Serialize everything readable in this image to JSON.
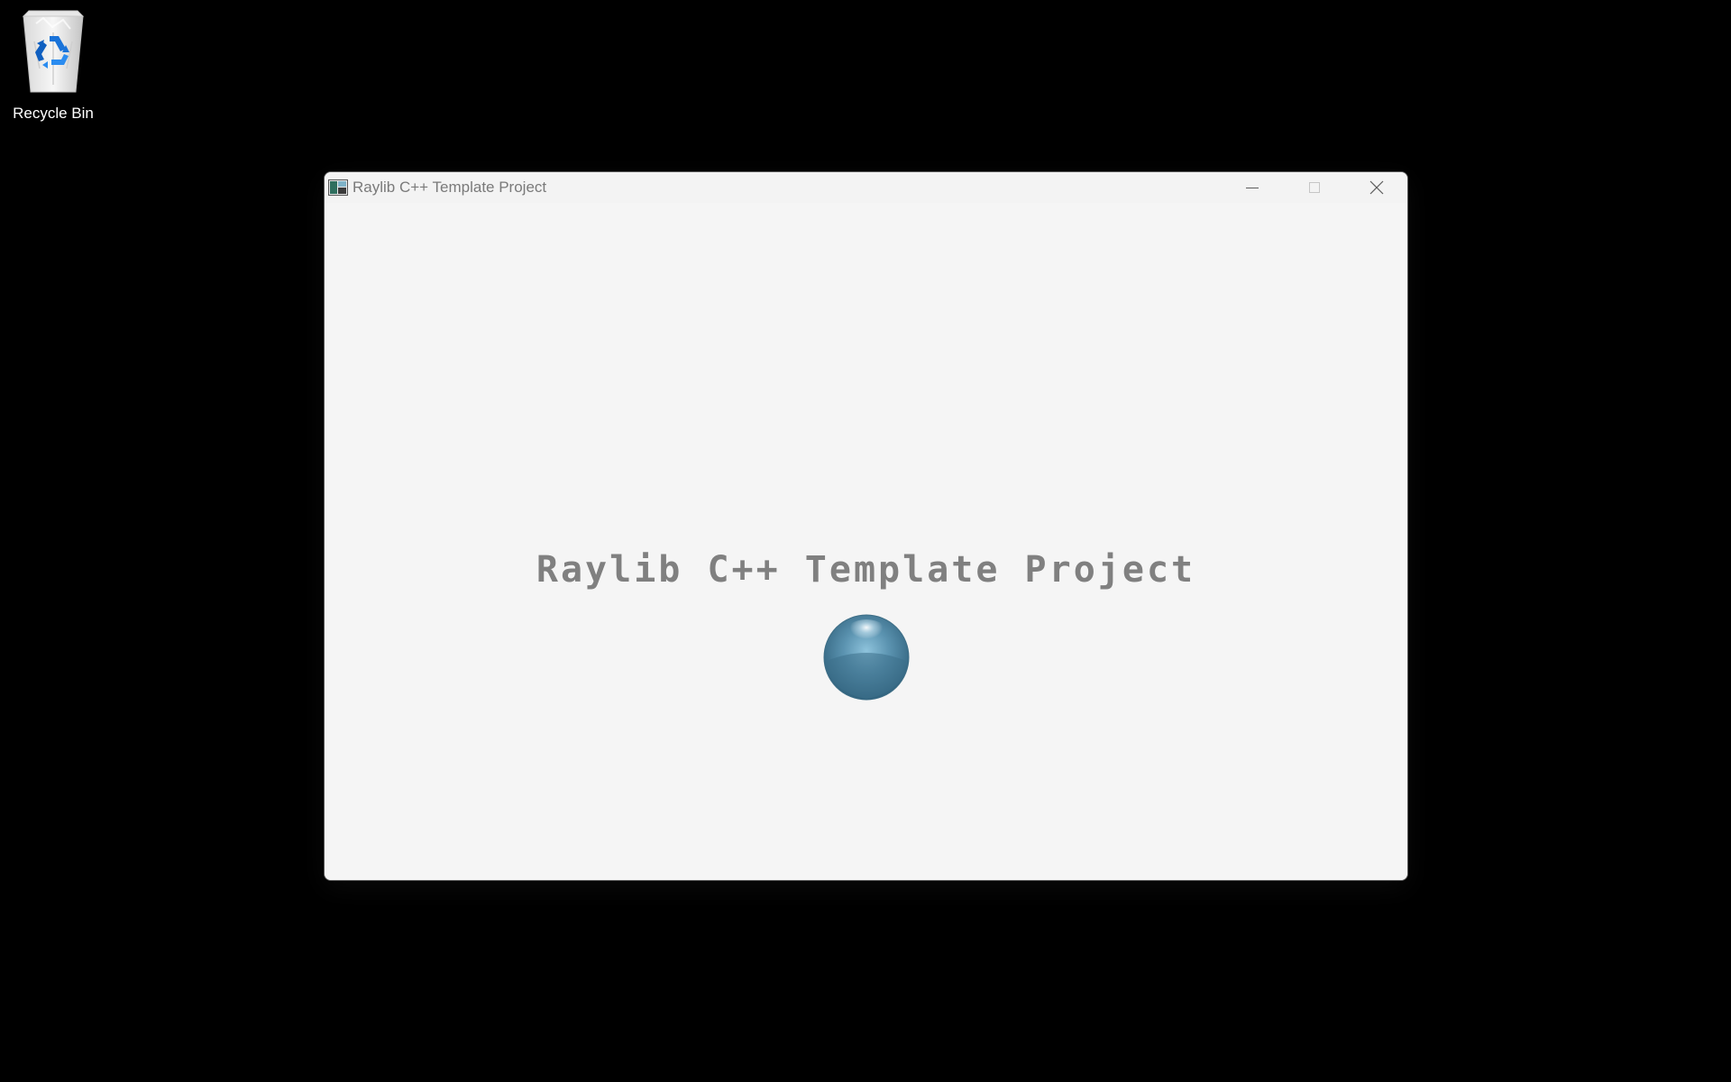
{
  "desktop": {
    "background": "#000000",
    "icons": [
      {
        "label": "Recycle Bin",
        "icon": "recycle-bin-icon"
      }
    ]
  },
  "window": {
    "title": "Raylib C++ Template Project",
    "icon": "raylib-app-icon",
    "caption_buttons": [
      "minimize-icon",
      "maximize-icon",
      "close-icon"
    ],
    "client": {
      "background": "#f5f5f5",
      "heading": "Raylib C++ Template Project",
      "heading_color": "#808080",
      "ball": {
        "icon": "sphere",
        "color": "#4a7f9c"
      }
    }
  }
}
